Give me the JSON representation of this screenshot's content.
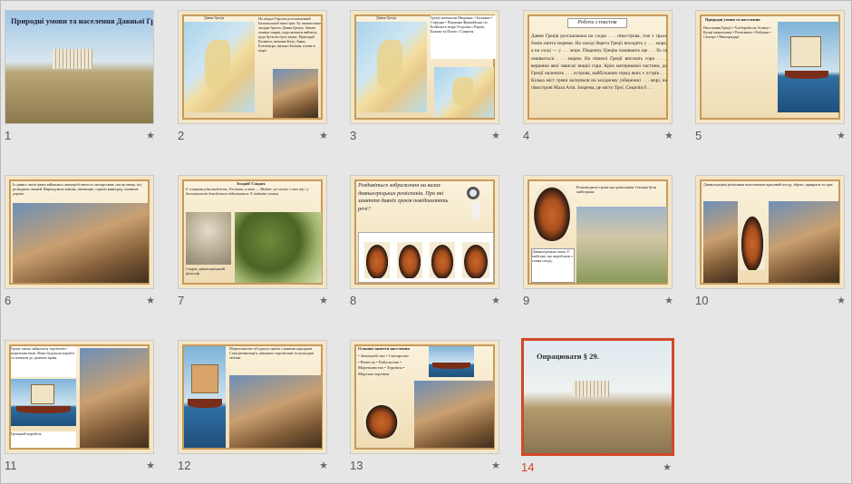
{
  "slides": [
    {
      "number": "1",
      "title": "Природні умови та населення Давньої Греції"
    },
    {
      "number": "2",
      "map_title": "Давня Греція",
      "text": "На півдні Європи розташований Балканський півострів. Бу звивистими західні брегах Давня Греція. Землю омиває ширкі, куди ковзати вийтися, куда бути пи було звуки. Пригадай Калипсо, вежами Балу, Анна, Клеопатра, пильно Балкан, пливе в море."
    },
    {
      "number": "3",
      "map_title": "Давня Греція",
      "list": "Греції належали Південна: • Балкани • Середня • Південна Фракийська по Егейского моря Острови з Пірею, Балкан та Понто і Сицилія",
      "note": "Грецькі держави Пригадайте Малу Азію"
    },
    {
      "number": "4",
      "title": "Робота з текстом",
      "text": "Давня Греція розташована на сходи . . . півострова, тож з трьох боків омита морями. На заході берега Греції виходить у . . . море, а на сході — у . . . море. Південну Грецію називають ще . . . бо та омивається . . . морем. На півночі Греції височать гори . . ., вершина якої зависає вищої гори. Крім материкової частини, до Греції належать . . . острова, найбільшим серед яких є острів . . . Кілька міст греки заснували на західному узбережжі . . . морі, на півострові Мала Азія. Зокрема, це місто Трої, Сицилія й . . ."
    },
    {
      "number": "5",
      "title": "Природні умови та населення",
      "list": "Населення Греції • Хлібороби на Аттиці • Купці мореплавці • Ремісники • Рибалки • Скотарі • Виноградарі",
      "note": "Грецькі купці торгували по всьому Середземному морю"
    },
    {
      "number": "6",
      "text": "Із давніх часів греки займались землеробством та скотарством, пасли овець, кіз, розводили свиней. Вирощували ячмінь, пшеницю, садили виноград, оливкові дерева."
    },
    {
      "number": "7",
      "title": "Згадай! Сократ.",
      "text": "Є оливкова різновидність. Гостини, а вона — Майже усі чисте з тих пір і у досконалості доведеться підніматися. Є видатні оливки.",
      "caption": "Сократ, давньогрецький філософ"
    },
    {
      "number": "8",
      "title": "Роздивіться зображення на вазах давньогрецьких ремісників. Про які заняття давніх греків повідомляють речі?"
    },
    {
      "number": "9",
      "text": "Розповідають греки про ремісників. Гончарі були майстрами.",
      "caption": "Давньогрецька чаша. Є майстри, що виробляли з глини посуд."
    },
    {
      "number": "10",
      "text": "Давньогрецькі ремісники виготовляли красивий посуд, зброю, прикраси та одяг."
    },
    {
      "number": "11",
      "text": "Греки також займалися торгівлею і мореплавством. Вони будували кораблі та плавали до далеких країн.",
      "note": "Грецький корабель"
    },
    {
      "number": "12",
      "text": "Мореплавство об'єднало греків з іншими народами Середземномор'я, зміцнило торгівельні та культурні зв'язки."
    },
    {
      "number": "13",
      "title": "Основні заняття населення",
      "list": "• Землеробство • Скотарство • Ремесло • Рибальство • Мореплавство • Торгівля • Морська торгівля"
    },
    {
      "number": "14",
      "title": "Опрацювати § 29."
    }
  ],
  "star_icon": "★",
  "selected_slide": "14",
  "colors": {
    "selection": "#d24726",
    "frame": "#c89a5a"
  }
}
